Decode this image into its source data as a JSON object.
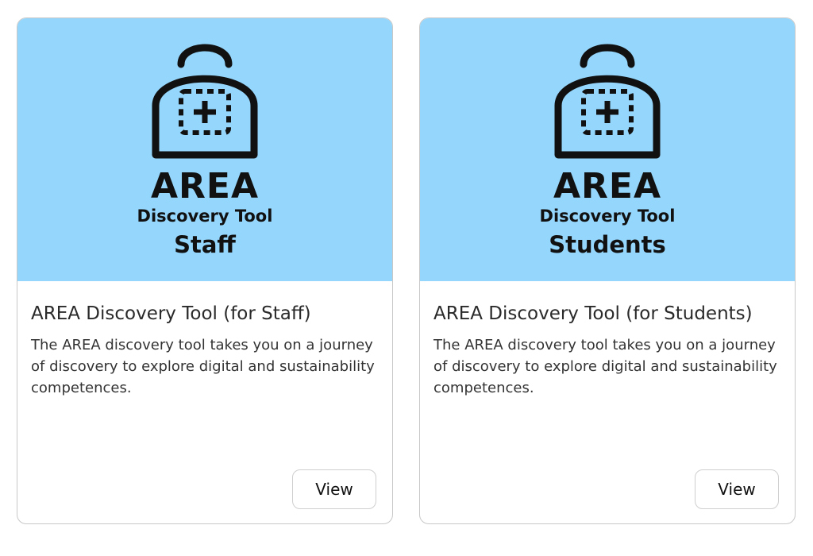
{
  "cards": [
    {
      "logo_title": "AREA",
      "logo_subtitle": "Discovery Tool",
      "logo_audience": "Staff",
      "title": "AREA Discovery Tool (for Staff)",
      "description": "The AREA discovery tool takes you on a journey of discovery to explore digital and sustainability competences.",
      "button_label": "View"
    },
    {
      "logo_title": "AREA",
      "logo_subtitle": "Discovery Tool",
      "logo_audience": "Students",
      "title": "AREA Discovery Tool (for Students)",
      "description": "The AREA discovery tool takes you on a journey of discovery to explore digital and sustainability competences.",
      "button_label": "View"
    }
  ],
  "colors": {
    "banner": "#95d6fc",
    "logo_ink": "#111111",
    "card_border": "#c8c8c8"
  },
  "icons": [
    "backpack-logo-icon"
  ]
}
